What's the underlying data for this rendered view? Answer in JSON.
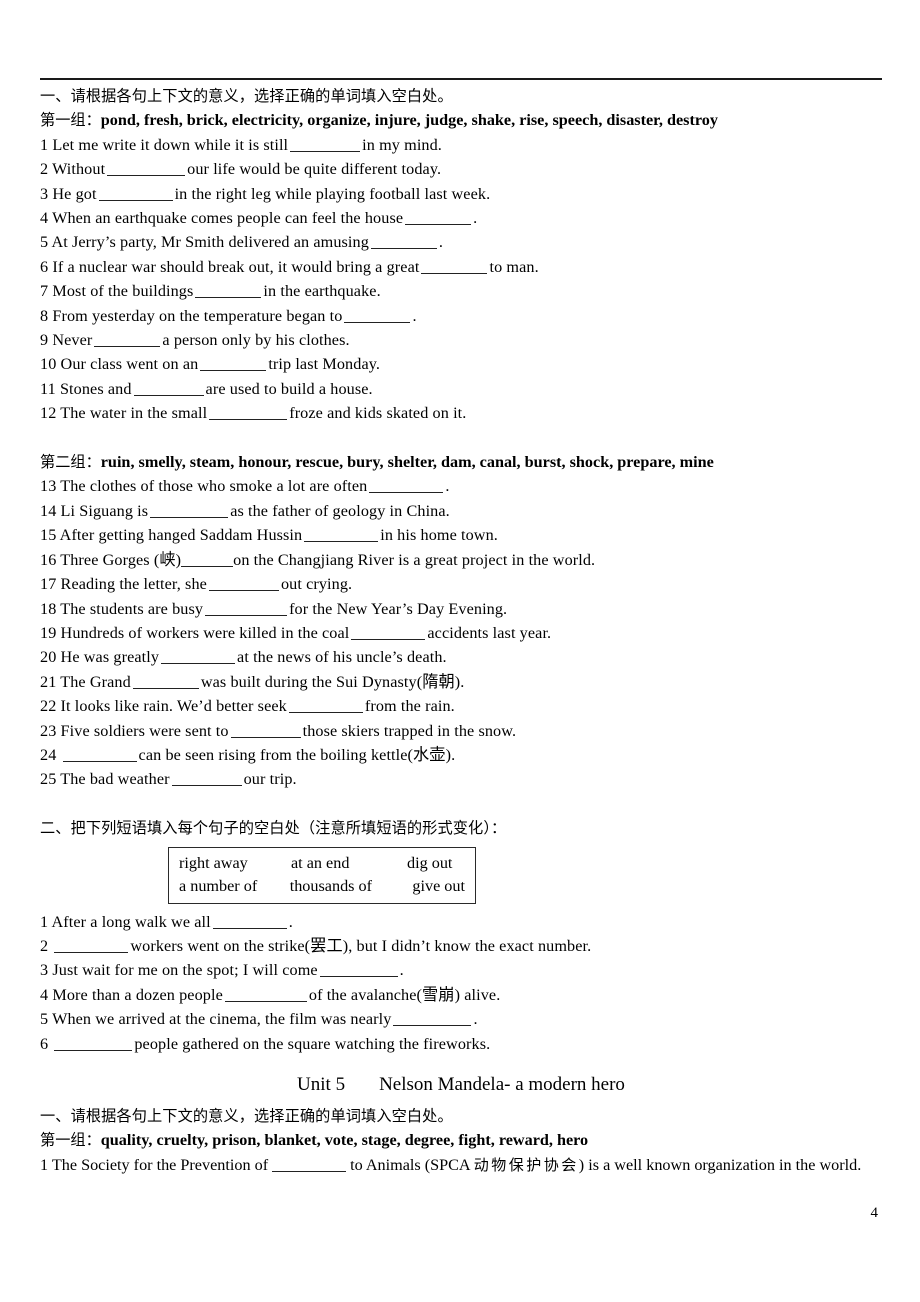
{
  "page": {
    "number": "4"
  },
  "section_one": {
    "heading": "一、请根据各句上下文的意义，选择正确的单词填入空白处。",
    "group1_label": "第一组：",
    "group1_words": "pond, fresh, brick, electricity, organize, injure, judge, shake, rise, speech, disaster, destroy",
    "group1_items": [
      {
        "num": "1",
        "pre": "Let me write it down while it is still",
        "post": "in my mind."
      },
      {
        "num": "2",
        "pre": "Without",
        "post": "our life would be quite different today."
      },
      {
        "num": "3",
        "pre": "He got",
        "post": "in the right leg while playing football last week."
      },
      {
        "num": "4",
        "pre": "When an earthquake comes people can feel the house",
        "post": "."
      },
      {
        "num": "5",
        "pre": "At Jerry’s party, Mr Smith delivered an amusing",
        "post": "."
      },
      {
        "num": "6",
        "pre": "If a nuclear war should break out, it would bring a great",
        "post": "to man."
      },
      {
        "num": "7",
        "pre": "Most of the buildings",
        "post": "in the earthquake."
      },
      {
        "num": "8",
        "pre": "From yesterday on the temperature began to",
        "post": "."
      },
      {
        "num": "9",
        "pre": "Never",
        "post": "a person only by his clothes."
      },
      {
        "num": "10",
        "pre": "Our class went on an",
        "post": "trip last Monday."
      },
      {
        "num": "11",
        "pre": "Stones and",
        "post": "are used to build a house."
      },
      {
        "num": "12",
        "pre": "The water in the small",
        "post": "froze and kids skated on it."
      }
    ],
    "group2_label": "第二组：",
    "group2_words": "ruin, smelly, steam, honour, rescue, bury, shelter, dam, canal, burst, shock, prepare, mine",
    "group2_items": [
      {
        "num": "13",
        "pre": "The clothes of those who smoke a lot are often",
        "post": "."
      },
      {
        "num": "14",
        "pre": "Li Siguang is",
        "post": "as the father of geology in China."
      },
      {
        "num": "15",
        "pre": "After getting hanged Saddam Hussin",
        "post": "in his home town."
      },
      {
        "num": "16",
        "pre": "Three Gorges (峡)",
        "post": "on the Changjiang River is a great project in the world."
      },
      {
        "num": "17",
        "pre": "Reading the letter, she",
        "post": "out crying."
      },
      {
        "num": "18",
        "pre": "The students are busy",
        "post": "for the New Year’s Day Evening."
      },
      {
        "num": "19",
        "pre": "Hundreds of workers were killed in the coal",
        "post": "accidents last year."
      },
      {
        "num": "20",
        "pre": "He was greatly",
        "post": "at the news of his uncle’s death."
      },
      {
        "num": "21",
        "pre": "The Grand",
        "post": "was built during the Sui Dynasty(隋朝)."
      },
      {
        "num": "22",
        "pre": "It looks like rain. We’d better seek",
        "post": "from the rain."
      },
      {
        "num": "23",
        "pre": "Five soldiers were sent to",
        "post": "those skiers trapped in the snow."
      },
      {
        "num": "24",
        "pre": "",
        "post": "can be seen rising from the boiling kettle(水壶)."
      },
      {
        "num": "25",
        "pre": "The bad weather",
        "post": "our trip."
      }
    ]
  },
  "section_two": {
    "heading": "二、把下列短语填入每个句子的空白处（注意所填短语的形式变化）：",
    "phrase_box": {
      "row1": [
        "right away",
        "at an end",
        "dig out"
      ],
      "row2": [
        "a number of",
        "thousands of",
        "give out"
      ]
    },
    "items": [
      {
        "num": "1",
        "pre": "After a long walk we all",
        "post": "."
      },
      {
        "num": "2",
        "pre": "",
        "post": "workers went on the strike(罢工), but I didn’t know the exact number."
      },
      {
        "num": "3",
        "pre": "Just wait for me on the spot; I will come",
        "post": "."
      },
      {
        "num": "4",
        "pre": "More than a dozen people",
        "post": "of the avalanche(雪崩) alive."
      },
      {
        "num": "5",
        "pre": "When we arrived at the cinema, the film was nearly",
        "post": "."
      },
      {
        "num": "6",
        "pre": "",
        "post": "people gathered on the square watching the fireworks."
      }
    ]
  },
  "unit5": {
    "label": "Unit 5",
    "title": "Nelson Mandela- a modern hero",
    "heading": "一、请根据各句上下文的意义，选择正确的单词填入空白处。",
    "group1_label": "第一组：",
    "group1_words": "quality, cruelty, prison, blanket, vote, stage, degree, fight, reward, hero",
    "item1": {
      "num": "1",
      "pre": "The Society for the Prevention of",
      "mid": "to Animals (SPCA",
      "cn": "动物保护协会",
      "post": ") is a well known organization in the world."
    }
  }
}
